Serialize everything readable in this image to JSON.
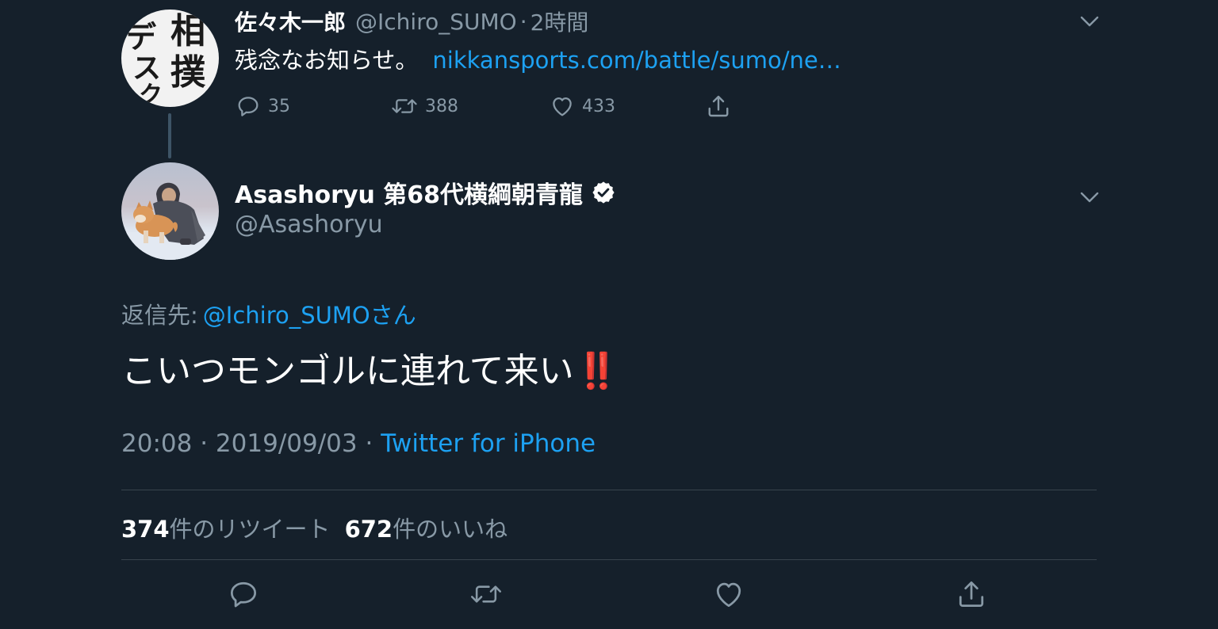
{
  "parent_tweet": {
    "author_name": "佐々木一郎",
    "handle": "@Ichiro_SUMO",
    "separator": "·",
    "time": "2時間",
    "avatar_text": [
      "相",
      "撲",
      "デ",
      "ス",
      "ク"
    ],
    "text": "残念なお知らせ。",
    "link": "nikkansports.com/battle/sumo/ne…",
    "actions": {
      "reply_count": "35",
      "retweet_count": "388",
      "like_count": "433"
    }
  },
  "focused_tweet": {
    "author_name": "Asashoryu 第68代横綱朝青龍",
    "verified": true,
    "handle": "@Asashoryu",
    "reply_label": "返信先:",
    "reply_mention": "@Ichiro_SUMOさん",
    "text": "こいつモンゴルに連れて来い",
    "emoji": "‼️",
    "time": "20:08",
    "sep1": "·",
    "date": "2019/09/03",
    "sep2": "·",
    "source": "Twitter for iPhone",
    "retweets_count": "374",
    "retweets_label": "件のリツイート",
    "likes_count": "672",
    "likes_label": "件のいいね"
  },
  "colors": {
    "background": "#15202b",
    "secondary_text": "#8899a6",
    "link": "#1da1f2",
    "divider": "#38444d",
    "emoji_red": "#e0201b"
  },
  "icons": [
    "chevron-down-icon",
    "reply-icon",
    "retweet-icon",
    "like-icon",
    "share-icon",
    "verified-badge-icon"
  ]
}
